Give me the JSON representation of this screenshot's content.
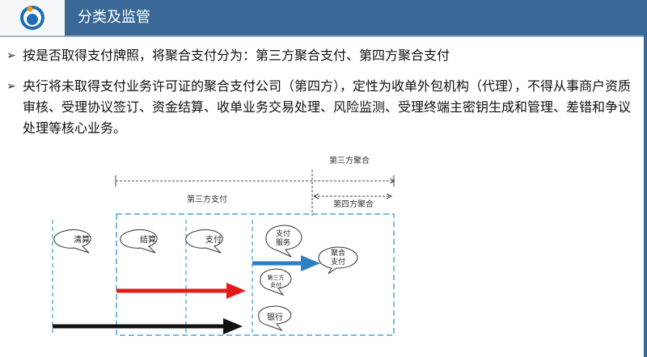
{
  "header": {
    "title": "分类及监管"
  },
  "bullets": [
    "按是否取得支付牌照，将聚合支付分为：第三方聚合支付、第四方聚合支付",
    "央行将未取得支付业务许可证的聚合支付公司（第四方），定性为收单外包机构（代理），不得从事商户资质审核、受理协议签订、资金结算、收单业务交易处理、风险监测、受理终端主密钥生成和管理、差错和争议处理等核心业务。"
  ],
  "diagram": {
    "label_third_aggregation": "第三方聚合",
    "label_third_payment": "第三方支付",
    "label_fourth_aggregation": "第四方聚合",
    "bubble_clearing": "清算",
    "bubble_settlement": "结算",
    "bubble_payment": "支付",
    "bubble_payment_service_1": "支付",
    "bubble_payment_service_2": "服务",
    "bubble_aggregated_payment_1": "聚合",
    "bubble_aggregated_payment_2": "支付",
    "bubble_third_party_1": "第三方",
    "bubble_third_party_2": "支付",
    "bubble_bank": "银行",
    "colors": {
      "blue_arrow": "#2f7ec4",
      "red_arrow": "#e41b1b",
      "black_arrow": "#111111",
      "dashed_border": "#4aa3d6"
    }
  }
}
